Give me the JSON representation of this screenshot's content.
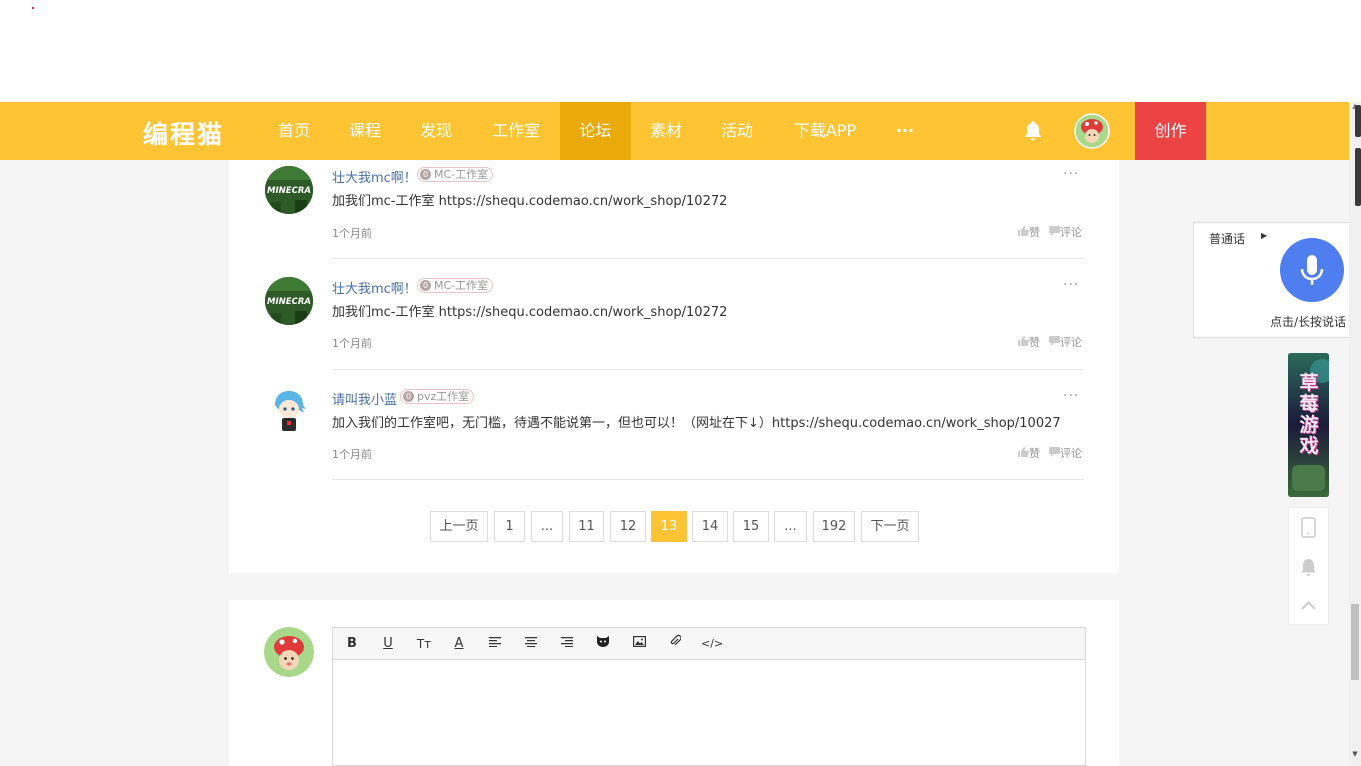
{
  "nav": {
    "logo": "编程猫",
    "items": [
      {
        "label": "首页"
      },
      {
        "label": "课程"
      },
      {
        "label": "发现"
      },
      {
        "label": "工作室"
      },
      {
        "label": "论坛",
        "active": true
      },
      {
        "label": "素材"
      },
      {
        "label": "活动"
      },
      {
        "label": "下载APP"
      }
    ],
    "more": "···",
    "create": "创作",
    "bell_icon": "bell-icon"
  },
  "replies": [
    {
      "user": "壮大我mc啊！",
      "badge_level": "0",
      "badge_text": "MC-工作室",
      "content": "加我们mc-工作室 https://shequ.codemao.cn/work_shop/10272",
      "time": "1个月前",
      "like": "赞",
      "comment": "评论",
      "more": "···",
      "avatar_text": "MINECRA"
    },
    {
      "user": "壮大我mc啊！",
      "badge_level": "0",
      "badge_text": "MC-工作室",
      "content": "加我们mc-工作室 https://shequ.codemao.cn/work_shop/10272",
      "time": "1个月前",
      "like": "赞",
      "comment": "评论",
      "more": "···",
      "avatar_text": "MINECRA"
    },
    {
      "user": "请叫我小蓝",
      "badge_level": "0",
      "badge_text": "pvz工作室",
      "content": "加入我们的工作室吧，无门槛，待遇不能说第一，但也可以！（网址在下↓）https://shequ.codemao.cn/work_shop/10027",
      "time": "1个月前",
      "like": "赞",
      "comment": "评论",
      "more": "···"
    }
  ],
  "pagination": {
    "prev": "上一页",
    "next": "下一页",
    "pages": [
      "1",
      "...",
      "11",
      "12",
      "13",
      "14",
      "15",
      "...",
      "192"
    ],
    "current": "13"
  },
  "editor": {
    "tools": [
      "bold-icon",
      "underline-icon",
      "font-size-icon",
      "font-color-icon",
      "align-left-icon",
      "align-center-icon",
      "align-right-icon",
      "emoji-cat-icon",
      "image-icon",
      "attachment-icon",
      "code-icon"
    ],
    "tool_glyphs": {
      "bold": "B",
      "underline": "U",
      "fontsize": "Tт",
      "fontcolor": "A",
      "code": "</>"
    }
  },
  "voice": {
    "language": "普通话",
    "hint": "点击/长按说话"
  },
  "side_banner": {
    "text": "草莓游戏"
  },
  "colors": {
    "nav_bg": "#fec433",
    "nav_active": "#eaaa0a",
    "create_bg": "#ec4345",
    "link": "#4a6fa5",
    "mic": "#4e7ef0"
  }
}
